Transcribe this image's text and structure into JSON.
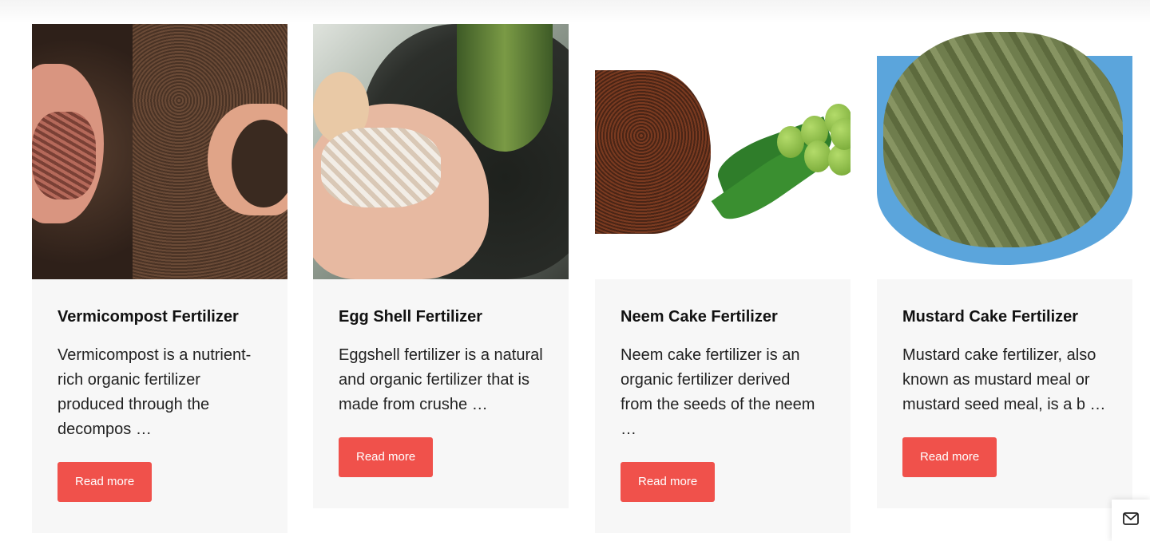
{
  "cards": [
    {
      "title": "Vermicompost Fertilizer",
      "excerpt": "Vermicompost is a nutrient-rich organic fertilizer produced through the decompos …",
      "button": "Read more",
      "image_alt": "Vermicompost Fertilizer image"
    },
    {
      "title": "Egg Shell Fertilizer",
      "excerpt": "Eggshell fertilizer is a natural and organic fertilizer that is made from crushe …",
      "button": "Read more",
      "image_alt": "Egg Shell Fertilizer image"
    },
    {
      "title": "Neem Cake Fertilizer",
      "excerpt": "Neem cake fertilizer is an organic fertilizer derived from the seeds of the neem …",
      "button": "Read more",
      "image_alt": "Neem Cake Fertilizer image"
    },
    {
      "title": "Mustard Cake Fertilizer",
      "excerpt": "Mustard cake fertilizer, also known as mustard meal or mustard seed meal, is a b …",
      "button": "Read more",
      "image_alt": "Mustard Cake Fertilizer image"
    }
  ],
  "colors": {
    "button_bg": "#f0514b",
    "card_bg": "#f7f7f7"
  },
  "floating": {
    "icon": "mail-icon"
  }
}
